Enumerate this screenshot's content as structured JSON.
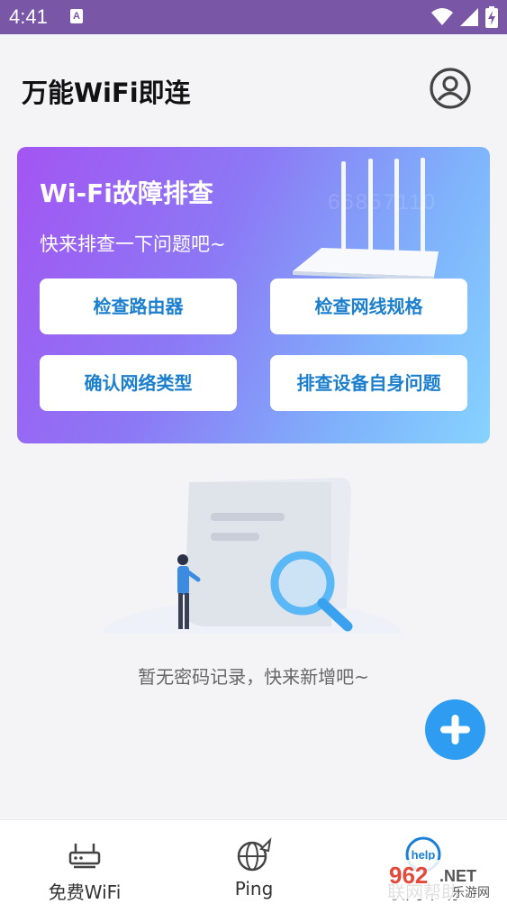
{
  "status_bar": {
    "time": "4:41",
    "notif_glyph": "A"
  },
  "header": {
    "title": "万能WiFi即连"
  },
  "card": {
    "title": "Wi-Fi故障排查",
    "subtitle": "快来排查一下问题吧~",
    "watermark": "66857110",
    "buttons": [
      "检查路由器",
      "检查网线规格",
      "确认网络类型",
      "排查设备自身问题"
    ]
  },
  "empty": {
    "message": "暂无密码记录，快来新增吧~"
  },
  "bottom_nav": {
    "items": [
      "免费WiFi",
      "Ping",
      "联网帮助"
    ],
    "help_badge": "help"
  },
  "watermark_logo": {
    "text": "962",
    "suffix": ".NET",
    "sub": "乐游网"
  },
  "colors": {
    "status_bar": "#7a57a6",
    "accent": "#2e9cf0",
    "button_text": "#1b7fce"
  }
}
